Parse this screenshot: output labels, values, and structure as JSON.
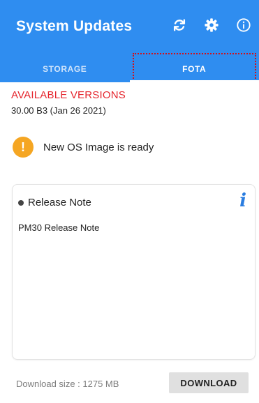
{
  "header": {
    "title": "System Updates",
    "actions": [
      {
        "icon": "refresh-icon"
      },
      {
        "icon": "gear-icon"
      },
      {
        "icon": "info-circle-icon"
      }
    ],
    "color": "#2f8df0"
  },
  "tabs": [
    {
      "label": "STORAGE",
      "active": false
    },
    {
      "label": "FOTA",
      "active": true
    }
  ],
  "versions": {
    "heading": "AVAILABLE VERSIONS",
    "current": "30.00 B3 (Jan 26 2021)"
  },
  "status": {
    "badge": "!",
    "message": "New OS Image is ready"
  },
  "release_note": {
    "title": "Release Note",
    "info_glyph": "i",
    "body": "PM30 Release Note"
  },
  "footer": {
    "download_size": "Download size : 1275 MB",
    "download_button": "DOWNLOAD"
  }
}
